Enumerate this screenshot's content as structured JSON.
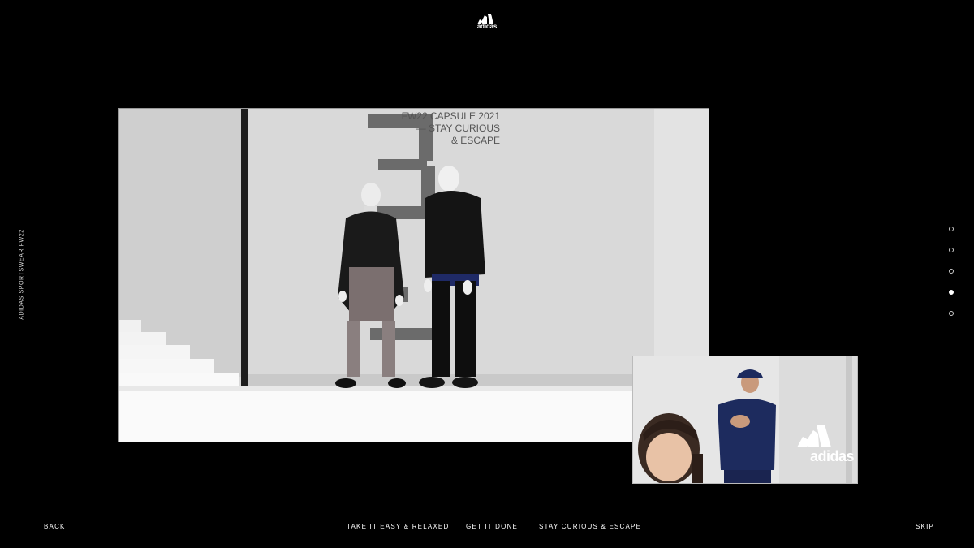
{
  "brand": {
    "name": "adidas",
    "icon": "adidas-performance-logo-icon"
  },
  "side_label": "ADIDAS SPORTSWEAR FW22",
  "scene": {
    "capsule_lines": [
      "FW22 CAPSULE 2021",
      "— STAY CURIOUS",
      "& ESCAPE"
    ],
    "big_numeral": "3"
  },
  "pip": {
    "brand_text": "adidas"
  },
  "pagination": {
    "count": 5,
    "active_index": 3
  },
  "nav": {
    "back": "BACK",
    "chapters": [
      {
        "label": "TAKE IT EASY & RELAXED",
        "active": false
      },
      {
        "label": "GET IT DONE",
        "active": false
      },
      {
        "label": "STAY CURIOUS & ESCAPE",
        "active": true
      }
    ],
    "skip": "SKIP"
  },
  "colors": {
    "background": "#000000",
    "text": "#ffffff",
    "scene_wall": "#dcdcdc"
  }
}
